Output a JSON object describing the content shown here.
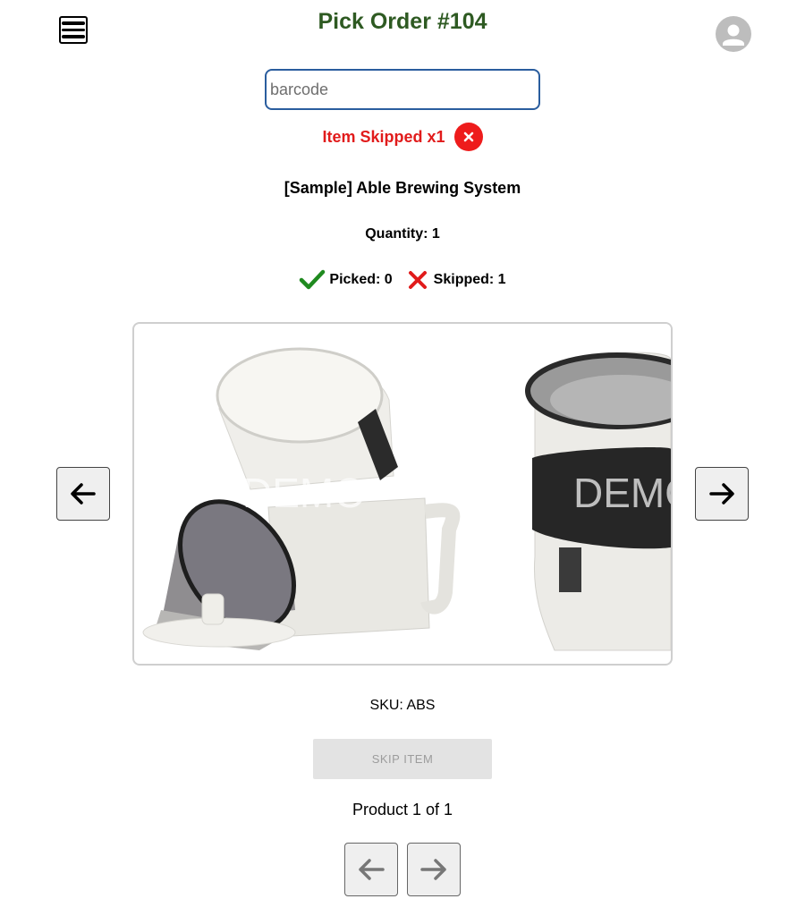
{
  "header": {
    "title": "Pick Order #104",
    "menu_icon": "hamburger-menu-icon",
    "avatar_icon": "user-avatar-icon"
  },
  "scan": {
    "placeholder": "barcode",
    "value": ""
  },
  "status": {
    "text": "Item Skipped x1",
    "color": "#e11b1b",
    "clear_icon": "close-icon"
  },
  "item": {
    "name": "[Sample] Able Brewing System",
    "quantity_text": "Quantity: 1",
    "picked_text": "Picked: 0",
    "skipped_text": "Skipped: 1",
    "sku_text": "SKU: ABS",
    "watermark": "DEMO"
  },
  "colors": {
    "title": "#2e5a22",
    "barcode_border": "#2a5d9e",
    "picked": "#1f8a1f",
    "skipped": "#e11b1b"
  },
  "actions": {
    "skip_label": "SKIP ITEM"
  },
  "pager": {
    "text": "Product 1 of 1"
  }
}
